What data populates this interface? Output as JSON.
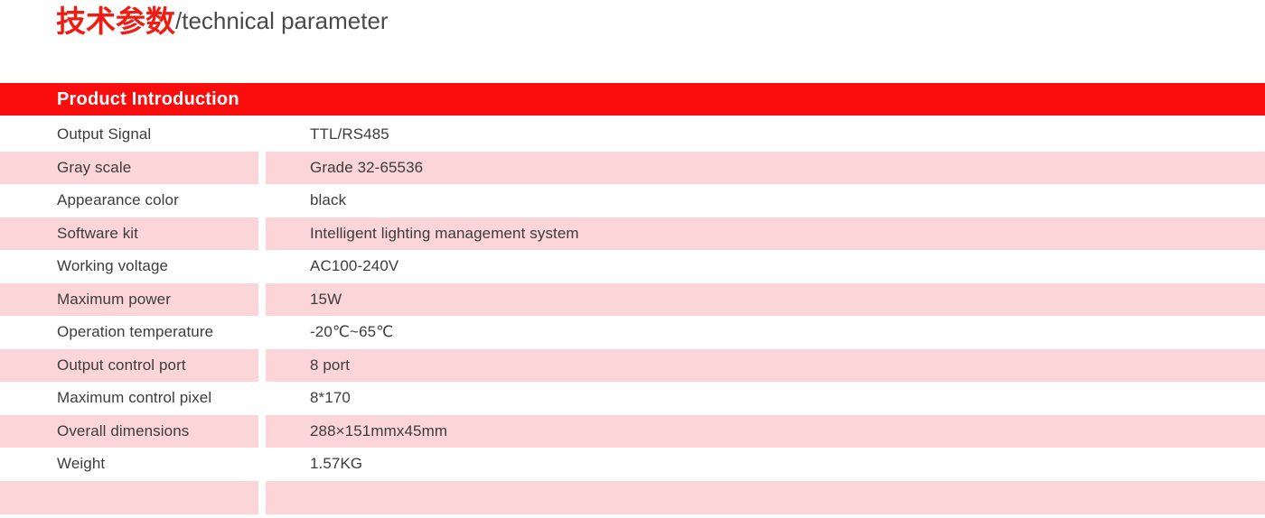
{
  "title": {
    "cn": "技术参数",
    "en": "/technical parameter",
    "cn_color": "#ee1c12",
    "en_color": "#4a4a4a"
  },
  "section": {
    "heading": "Product Introduction",
    "bar_color": "#fb0d0d",
    "text_color": "#ffffff"
  },
  "table": {
    "row_alt_color": "#fbd5d8",
    "text_color": "#3c3c3c",
    "rows": [
      {
        "label": "Output Signal",
        "value": "TTL/RS485"
      },
      {
        "label": "Gray scale",
        "value": "Grade 32-65536"
      },
      {
        "label": "Appearance color",
        "value": "black"
      },
      {
        "label": "Software kit",
        "value": "Intelligent lighting management system"
      },
      {
        "label": "Working voltage",
        "value": "AC100-240V"
      },
      {
        "label": "Maximum power",
        "value": "15W"
      },
      {
        "label": "Operation temperature",
        "value": "-20℃~65℃"
      },
      {
        "label": "Output control port",
        "value": "8 port"
      },
      {
        "label": "Maximum control pixel",
        "value": "8*170"
      },
      {
        "label": "Overall dimensions",
        "value": "288×151mmx45mm"
      },
      {
        "label": "Weight",
        "value": "1.57KG"
      },
      {
        "label": "",
        "value": ""
      }
    ]
  }
}
